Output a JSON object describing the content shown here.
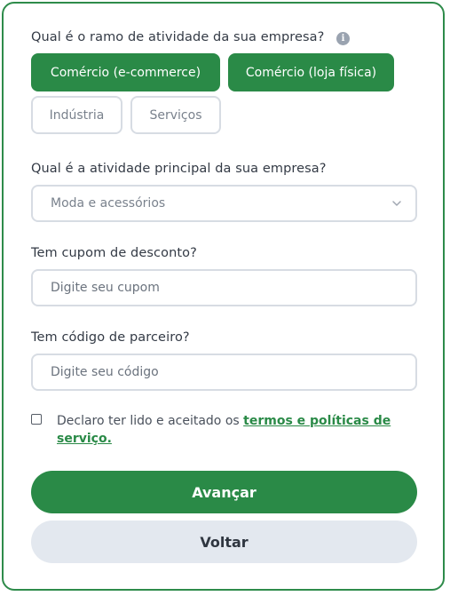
{
  "form": {
    "segment_question": "Qual é o ramo de atividade da sua empresa?",
    "info_icon": "info-icon",
    "segments": [
      {
        "label": "Comércio (e-commerce)",
        "selected": true
      },
      {
        "label": "Comércio (loja física)",
        "selected": true
      },
      {
        "label": "Indústria",
        "selected": false
      },
      {
        "label": "Serviços",
        "selected": false
      }
    ],
    "activity_question": "Qual é a atividade principal da sua empresa?",
    "activity_value": "Moda e acessórios",
    "coupon_question": "Tem cupom de desconto?",
    "coupon_placeholder": "Digite seu cupom",
    "partner_question": "Tem código de parceiro?",
    "partner_placeholder": "Digite seu código",
    "terms_text": "Declaro ter lido e aceitado os ",
    "terms_link": "termos e políticas de serviço.",
    "terms_checked": false,
    "next_label": "Avançar",
    "back_label": "Voltar"
  },
  "colors": {
    "brand_green": "#2a8a47",
    "border_gray": "#d7dce3",
    "secondary_button": "#e3e8ef"
  }
}
